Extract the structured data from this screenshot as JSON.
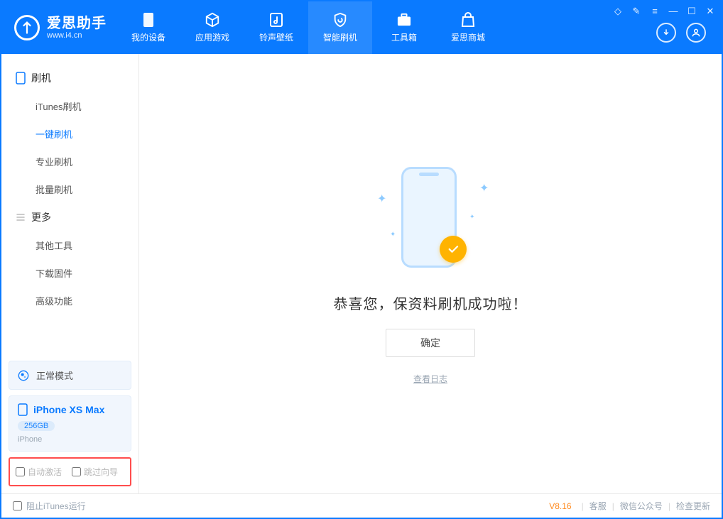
{
  "brand": {
    "cn": "爱思助手",
    "url": "www.i4.cn"
  },
  "nav": {
    "items": [
      {
        "label": "我的设备"
      },
      {
        "label": "应用游戏"
      },
      {
        "label": "铃声壁纸"
      },
      {
        "label": "智能刷机"
      },
      {
        "label": "工具箱"
      },
      {
        "label": "爱思商城"
      }
    ],
    "active_index": 3
  },
  "sidebar": {
    "groups": [
      {
        "title": "刷机",
        "items": [
          "iTunes刷机",
          "一键刷机",
          "专业刷机",
          "批量刷机"
        ],
        "active_index": 1
      },
      {
        "title": "更多",
        "items": [
          "其他工具",
          "下载固件",
          "高级功能"
        ],
        "active_index": -1
      }
    ],
    "status": {
      "text": "正常模式"
    },
    "device": {
      "name": "iPhone XS Max",
      "storage": "256GB",
      "type": "iPhone"
    },
    "options": {
      "auto_activate": {
        "label": "自动激活",
        "checked": false
      },
      "skip_guide": {
        "label": "跳过向导",
        "checked": false
      }
    }
  },
  "main": {
    "success_message": "恭喜您，保资料刷机成功啦！",
    "ok_button": "确定",
    "view_log": "查看日志"
  },
  "footer": {
    "block_itunes": {
      "label": "阻止iTunes运行",
      "checked": false
    },
    "version": "V8.16",
    "links": [
      "客服",
      "微信公众号",
      "检查更新"
    ]
  }
}
